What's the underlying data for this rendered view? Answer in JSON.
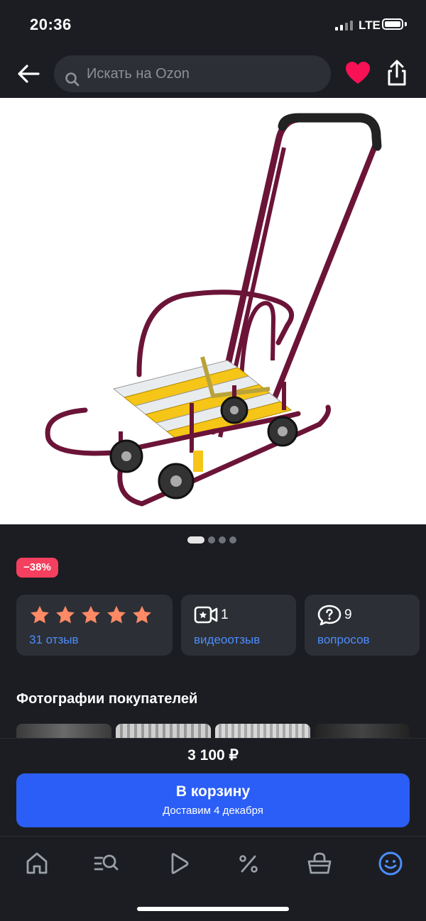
{
  "status": {
    "time": "20:36",
    "network": "LTE",
    "battery_percent": 100
  },
  "search": {
    "placeholder": "Искать на Ozon"
  },
  "icons": {
    "back": "back-arrow-icon",
    "search": "magnifier-icon",
    "favorite": "heart-icon",
    "share": "share-icon",
    "video": "video-camera-icon",
    "questions": "question-bubble-icon"
  },
  "gallery": {
    "image_count": 4,
    "active_index": 0
  },
  "product": {
    "discount_badge": "−38%",
    "rating_stars": 5,
    "reviews_label": "31 отзыв",
    "video_count": "1",
    "video_label": "видеоотзыв",
    "questions_count": "9",
    "questions_label": "вопросов"
  },
  "customer_photos": {
    "title": "Фотографии покупателей"
  },
  "buy": {
    "price": "3 100 ₽",
    "button_label": "В корзину",
    "delivery": "Доставим 4 декабря"
  },
  "tabs": [
    "home-icon",
    "catalog-search-icon",
    "play-icon",
    "percent-icon",
    "basket-icon",
    "profile-smile-icon"
  ],
  "colors": {
    "background": "#1b1d22",
    "card": "#2c2f35",
    "accent": "#2b5ef6",
    "link": "#4c8dff",
    "discount": "#f43f5e",
    "heart": "#f91155",
    "star": "#ff8a65",
    "sled_frame": "#6b1438",
    "sled_slat_yellow": "#f5c518"
  }
}
